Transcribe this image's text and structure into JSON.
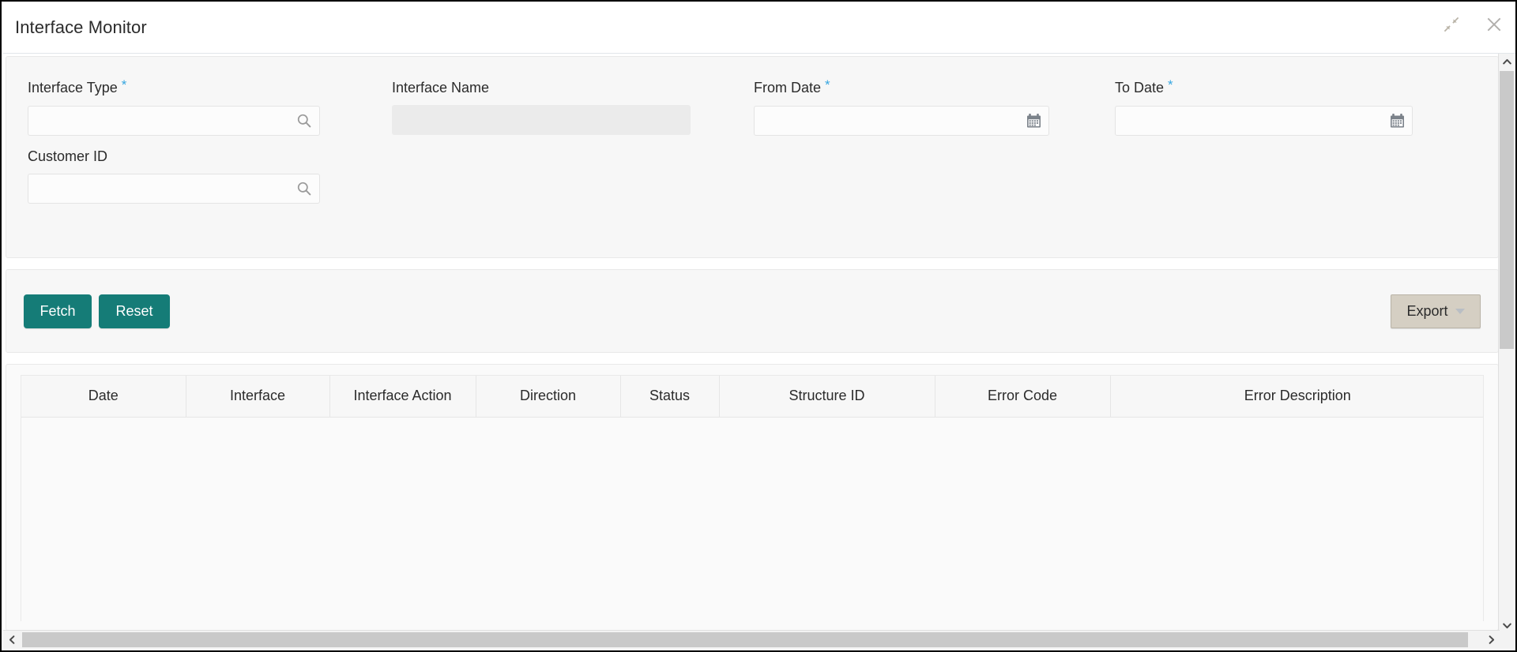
{
  "window": {
    "title": "Interface Monitor",
    "actions": [
      {
        "name": "minimize-restore",
        "icon": "collapse-arrows-icon"
      },
      {
        "name": "close",
        "icon": "close-icon"
      }
    ]
  },
  "colors": {
    "primary_button": "#157c77",
    "export_button": "#d5cfc3",
    "required_asterisk": "#37a6e0",
    "panel_background": "#f7f7f7",
    "scrollbar_thumb": "#c9c9c9"
  },
  "filters": {
    "fields": [
      {
        "label": "Interface Type",
        "required": true,
        "value": "",
        "placeholder": "",
        "icon": "search-icon",
        "disabled": false
      },
      {
        "label": "Interface Name",
        "required": false,
        "value": "",
        "placeholder": "",
        "icon": "",
        "disabled": true
      },
      {
        "label": "From Date",
        "required": true,
        "value": "",
        "placeholder": "",
        "icon": "calendar-icon",
        "disabled": false
      },
      {
        "label": "To Date",
        "required": true,
        "value": "",
        "placeholder": "",
        "icon": "calendar-icon",
        "disabled": false
      },
      {
        "label": "Customer ID",
        "required": false,
        "value": "",
        "placeholder": "",
        "icon": "search-icon",
        "disabled": false
      }
    ],
    "required_marker": "*"
  },
  "actions": {
    "fetch_label": "Fetch",
    "reset_label": "Reset",
    "export_label": "Export",
    "export_caret": "chevron-down-icon"
  },
  "results": {
    "columns": [
      "Date",
      "Interface",
      "Interface Action",
      "Direction",
      "Status",
      "Structure ID",
      "Error Code",
      "Error Description"
    ],
    "rows": [],
    "empty": true
  },
  "scrollbars": {
    "vertical": {
      "up": "chevron-up-icon",
      "down": "chevron-down-icon"
    },
    "horizontal": {
      "left": "chevron-left-icon",
      "right": "chevron-right-icon"
    }
  }
}
